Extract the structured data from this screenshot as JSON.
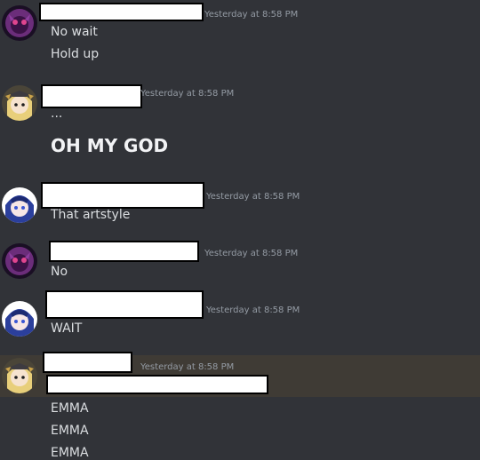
{
  "timestamp": "Yesterday at 8:58 PM",
  "messages": [
    {
      "lines": [
        "No wait",
        "Hold up"
      ],
      "avatar": "purple-shadow-avatar-icon"
    },
    {
      "lines": [
        "...",
        "OH MY GOD"
      ],
      "avatar": "blonde-girl-avatar-icon"
    },
    {
      "lines": [
        "That artstyle"
      ],
      "avatar": "blue-hair-girl-avatar-icon"
    },
    {
      "lines": [
        "No"
      ],
      "avatar": "purple-shadow-avatar-icon"
    },
    {
      "lines": [
        "WAIT"
      ],
      "avatar": "blue-hair-girl-avatar-icon"
    },
    {
      "lines": [
        "EMMA",
        "EMMA",
        "EMMA"
      ],
      "avatar": "blonde-girl-avatar-icon"
    }
  ],
  "colors": {
    "background": "#313338",
    "highlight": "#3f3b35",
    "text": "#dbdee1",
    "timestamp": "#949ba4",
    "redaction": "#ffffff"
  }
}
